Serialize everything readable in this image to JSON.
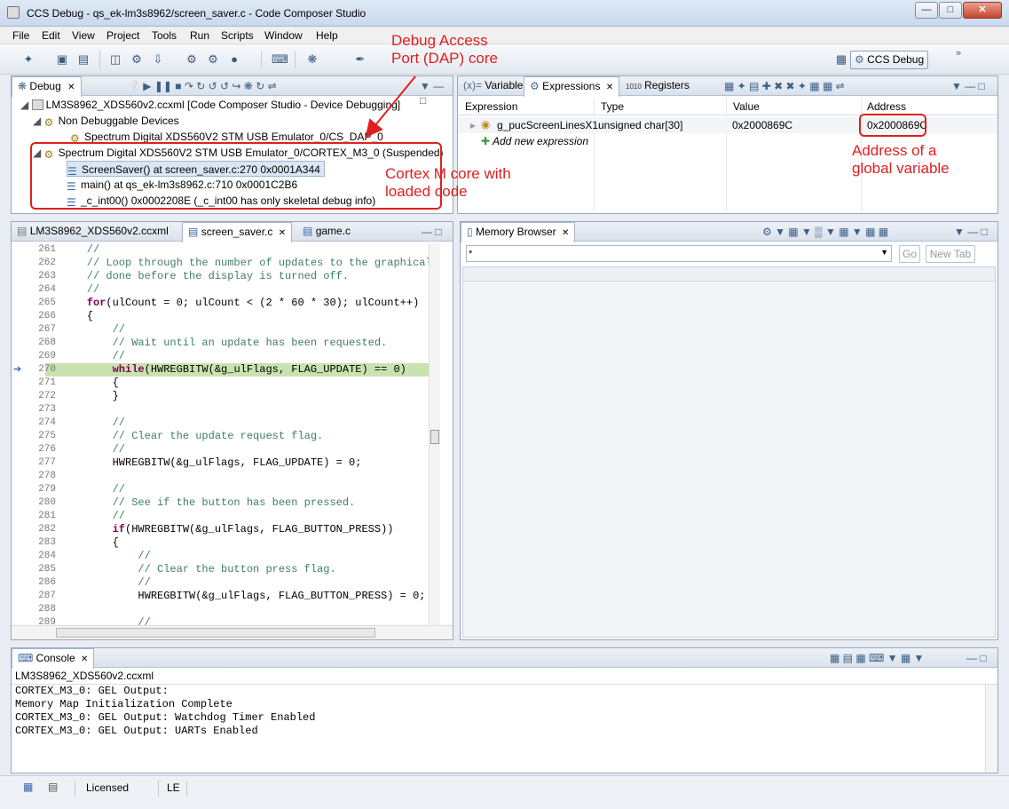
{
  "window": {
    "title": "CCS Debug - qs_ek-lm3s8962/screen_saver.c - Code Composer Studio"
  },
  "menu": [
    "File",
    "Edit",
    "View",
    "Project",
    "Tools",
    "Run",
    "Scripts",
    "Window",
    "Help"
  ],
  "perspective": {
    "label": "CCS Debug"
  },
  "debug_view": {
    "tab": "Debug",
    "tree": [
      {
        "text": "LM3S8962_XDS560v2.ccxml [Code Composer Studio - Device Debugging]",
        "icon": "device-debug-icon"
      },
      {
        "text": "Non Debuggable Devices",
        "icon": "devices-icon"
      },
      {
        "text": "Spectrum Digital XDS560V2 STM USB Emulator_0/CS_DAP_0",
        "icon": "dap-icon"
      },
      {
        "text": "Spectrum Digital XDS560V2 STM USB Emulator_0/CORTEX_M3_0 (Suspended)",
        "icon": "cpu-suspended-icon"
      },
      {
        "text": "ScreenSaver() at screen_saver.c:270 0x0001A344",
        "icon": "stack-frame-icon"
      },
      {
        "text": "main() at qs_ek-lm3s8962.c:710 0x0001C2B6",
        "icon": "stack-frame-icon"
      },
      {
        "text": "_c_int00() 0x0002208E  (_c_int00 has only skeletal debug info)",
        "icon": "stack-frame-icon"
      }
    ]
  },
  "expressions_view": {
    "tabs": [
      "Variables",
      "Expressions",
      "Registers"
    ],
    "columns": [
      "Expression",
      "Type",
      "Value",
      "Address"
    ],
    "rows": [
      {
        "expression": "g_pucScreenLinesX1",
        "type": "unsigned char[30]",
        "value": "0x2000869C",
        "address": "0x2000869C"
      }
    ],
    "add_new": "Add new expression"
  },
  "editor": {
    "tabs": [
      "LM3S8962_XDS560v2.ccxml",
      "screen_saver.c",
      "game.c"
    ],
    "lines": [
      {
        "n": "261",
        "t": "    //",
        "c": "cm"
      },
      {
        "n": "262",
        "t": "    // Loop through the number of updates to the graphical scr",
        "c": "cm"
      },
      {
        "n": "263",
        "t": "    // done before the display is turned off.",
        "c": "cm"
      },
      {
        "n": "264",
        "t": "    //",
        "c": "cm"
      },
      {
        "n": "265",
        "kw": "for",
        "t": "(ulCount = 0; ulCount < (2 * 60 * 30); ulCount++)",
        "indent": "    "
      },
      {
        "n": "266",
        "t": "    {",
        "c": ""
      },
      {
        "n": "267",
        "t": "        //",
        "c": "cm"
      },
      {
        "n": "268",
        "t": "        // Wait until an update has been requested.",
        "c": "cm"
      },
      {
        "n": "269",
        "t": "        //",
        "c": "cm"
      },
      {
        "n": "270",
        "kw": "while",
        "t": "(HWREGBITW(&g_ulFlags, FLAG_UPDATE) == 0)",
        "indent": "        ",
        "hl": true
      },
      {
        "n": "271",
        "t": "        {",
        "c": ""
      },
      {
        "n": "272",
        "t": "        }",
        "c": ""
      },
      {
        "n": "273",
        "t": "",
        "c": ""
      },
      {
        "n": "274",
        "t": "        //",
        "c": "cm"
      },
      {
        "n": "275",
        "t": "        // Clear the update request flag.",
        "c": "cm"
      },
      {
        "n": "276",
        "t": "        //",
        "c": "cm"
      },
      {
        "n": "277",
        "t": "        HWREGBITW(&g_ulFlags, FLAG_UPDATE) = 0;",
        "c": ""
      },
      {
        "n": "278",
        "t": "",
        "c": ""
      },
      {
        "n": "279",
        "t": "        //",
        "c": "cm"
      },
      {
        "n": "280",
        "t": "        // See if the button has been pressed.",
        "c": "cm"
      },
      {
        "n": "281",
        "t": "        //",
        "c": "cm"
      },
      {
        "n": "282",
        "kw": "if",
        "t": "(HWREGBITW(&g_ulFlags, FLAG_BUTTON_PRESS))",
        "indent": "        "
      },
      {
        "n": "283",
        "t": "        {",
        "c": ""
      },
      {
        "n": "284",
        "t": "            //",
        "c": "cm"
      },
      {
        "n": "285",
        "t": "            // Clear the button press flag.",
        "c": "cm"
      },
      {
        "n": "286",
        "t": "            //",
        "c": "cm"
      },
      {
        "n": "287",
        "t": "            HWREGBITW(&g_ulFlags, FLAG_BUTTON_PRESS) = 0;",
        "c": ""
      },
      {
        "n": "288",
        "t": "",
        "c": ""
      },
      {
        "n": "289",
        "t": "            //",
        "c": "cm"
      }
    ]
  },
  "memory_view": {
    "tab": "Memory Browser",
    "address_value": "",
    "go_label": "Go",
    "newtab_label": "New Tab"
  },
  "console": {
    "tab": "Console",
    "subtitle": "LM3S8962_XDS560v2.ccxml",
    "lines": [
      "CORTEX_M3_0: GEL Output:",
      "Memory Map Initialization Complete",
      "CORTEX_M3_0: GEL Output: Watchdog Timer Enabled",
      "CORTEX_M3_0: GEL Output: UARTs Enabled"
    ]
  },
  "status": {
    "license": "Licensed",
    "endian": "LE"
  },
  "annotations": {
    "dap": [
      "Debug Access",
      "Port (DAP) core"
    ],
    "cortex": [
      "Cortex M core with",
      "loaded code"
    ],
    "global": [
      "Address of a",
      "global variable"
    ]
  },
  "colors": {
    "annotation": "#e02020",
    "highlight_line": "#c9e3b0",
    "comment": "#3f7f5f",
    "keyword": "#7f0055"
  }
}
